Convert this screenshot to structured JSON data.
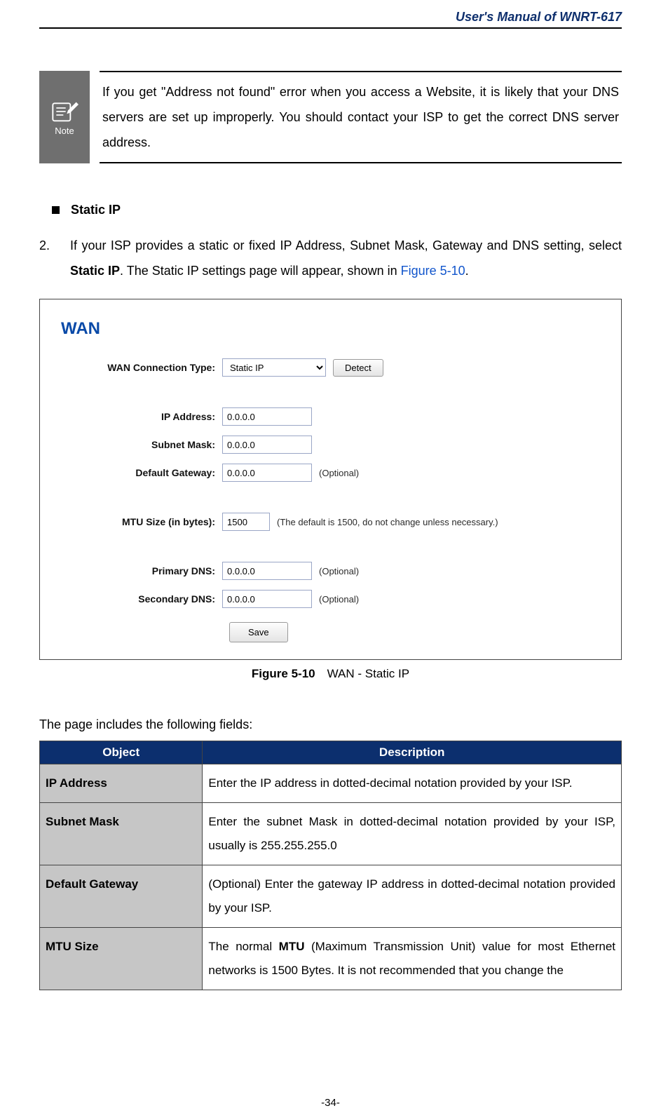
{
  "header": {
    "title": "User's Manual of WNRT-617"
  },
  "note": {
    "iconLabel": "Note",
    "text": "If you get \"Address not found\" error when you access a Website, it is likely that your DNS servers are set up improperly. You should contact your ISP to get the correct DNS server address."
  },
  "section": {
    "bulletTitle": "Static IP"
  },
  "step": {
    "number": "2.",
    "text_a": "If your ISP provides a static or fixed IP Address, Subnet Mask, Gateway and DNS setting, select ",
    "text_b_bold": "Static IP",
    "text_c": ". The Static IP settings page will appear, shown in ",
    "figref": "Figure 5-10",
    "text_d": "."
  },
  "ui": {
    "panelTitle": "WAN",
    "labels": {
      "connType": "WAN Connection Type:",
      "ip": "IP Address:",
      "mask": "Subnet Mask:",
      "gw": "Default Gateway:",
      "mtu": "MTU Size (in bytes):",
      "pdns": "Primary DNS:",
      "sdns": "Secondary DNS:"
    },
    "values": {
      "connType": "Static IP",
      "detect": "Detect",
      "ip": "0.0.0.0",
      "mask": "0.0.0.0",
      "gw": "0.0.0.0",
      "mtu": "1500",
      "pdns": "0.0.0.0",
      "sdns": "0.0.0.0",
      "save": "Save"
    },
    "hints": {
      "optional": "(Optional)",
      "mtu": "(The default is 1500, do not change unless necessary.)"
    }
  },
  "caption": {
    "bold": "Figure 5-10",
    "rest": " WAN - Static IP"
  },
  "fieldsIntro": "The page includes the following fields:",
  "table": {
    "headers": {
      "object": "Object",
      "description": "Description"
    },
    "rows": [
      {
        "obj": "IP Address",
        "desc_a": "Enter the IP address in dotted-decimal notation provided by your ISP."
      },
      {
        "obj": "Subnet Mask",
        "desc_a": "Enter the subnet Mask in dotted-decimal notation provided by your ISP, usually is 255.255.255.0"
      },
      {
        "obj": "Default Gateway",
        "desc_a": "(Optional) Enter the gateway IP address in dotted-decimal notation provided by your ISP."
      },
      {
        "obj": "MTU Size",
        "desc_a": "The normal ",
        "desc_bold": "MTU",
        "desc_b": " (Maximum Transmission Unit) value for most Ethernet networks is 1500 Bytes. It is not recommended that you change the"
      }
    ]
  },
  "pageNumber": "-34-"
}
